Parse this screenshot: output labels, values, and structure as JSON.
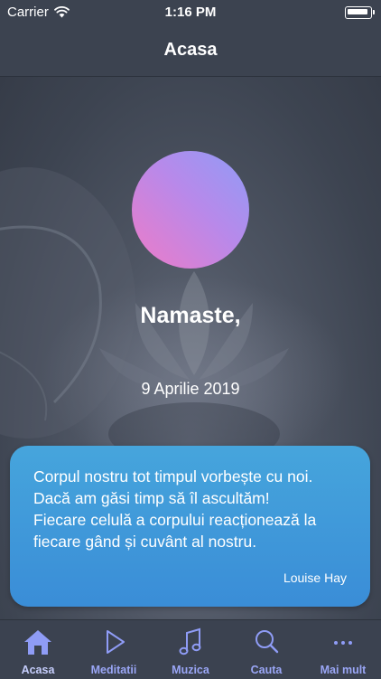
{
  "status_bar": {
    "carrier": "Carrier",
    "time": "1:16 PM"
  },
  "nav": {
    "title": "Acasa"
  },
  "home": {
    "greeting": "Namaste,",
    "date": "9 Aprilie 2019"
  },
  "quote": {
    "lines": [
      "Corpul nostru tot timpul vorbește cu noi.",
      "Dacă am găsi timp să îl ascultăm!",
      "Fiecare celulă a corpului reacționează la",
      "fiecare gând și cuvânt al nostru."
    ],
    "author": "Louise Hay"
  },
  "tabs": [
    {
      "label": "Acasa",
      "icon": "home-icon",
      "active": true
    },
    {
      "label": "Meditatii",
      "icon": "play-icon",
      "active": false
    },
    {
      "label": "Muzica",
      "icon": "music-note-icon",
      "active": false
    },
    {
      "label": "Cauta",
      "icon": "search-icon",
      "active": false
    },
    {
      "label": "Mai mult",
      "icon": "more-icon",
      "active": false
    }
  ],
  "colors": {
    "accent": "#8f9cf6",
    "orb_start": "#8f9cf6",
    "orb_end": "#ee7bc7",
    "card": "#3d94d9",
    "bar": "#3c4350"
  }
}
